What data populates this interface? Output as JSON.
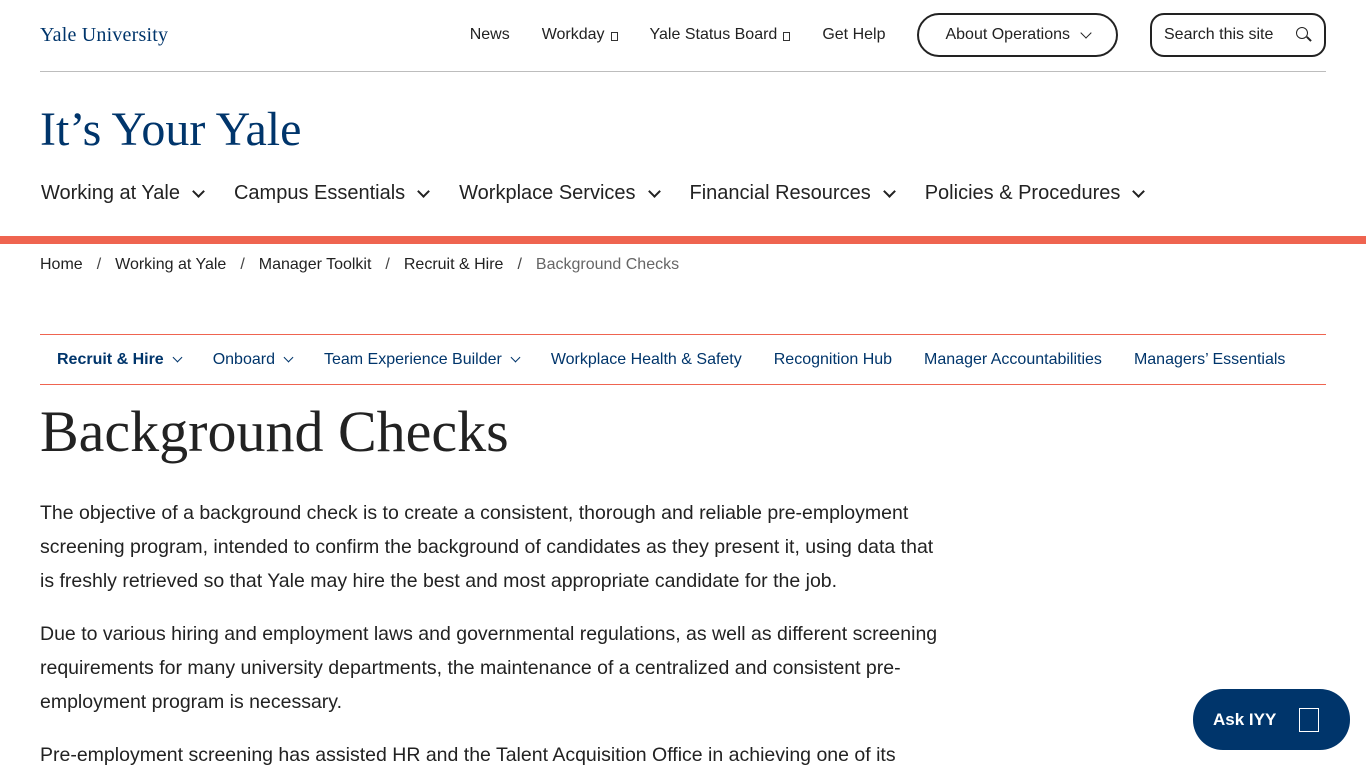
{
  "header": {
    "logo": "Yale University",
    "links": [
      {
        "label": "News",
        "external": false
      },
      {
        "label": "Workday",
        "external": true
      },
      {
        "label": "Yale Status Board",
        "external": true
      },
      {
        "label": "Get Help",
        "external": false
      }
    ],
    "about_button": "About Operations",
    "search_placeholder": "Search this site"
  },
  "site_title": "It’s Your Yale",
  "main_nav": [
    "Working at Yale",
    "Campus Essentials",
    "Workplace Services",
    "Financial Resources",
    "Policies & Procedures"
  ],
  "breadcrumb": [
    "Home",
    "Working at Yale",
    "Manager Toolkit",
    "Recruit & Hire",
    "Background Checks"
  ],
  "sub_nav": [
    {
      "label": "Recruit & Hire",
      "dropdown": true,
      "active": true
    },
    {
      "label": "Onboard",
      "dropdown": true,
      "active": false
    },
    {
      "label": "Team Experience Builder",
      "dropdown": true,
      "active": false
    },
    {
      "label": "Workplace Health & Safety",
      "dropdown": false,
      "active": false
    },
    {
      "label": "Recognition Hub",
      "dropdown": false,
      "active": false
    },
    {
      "label": "Manager Accountabilities",
      "dropdown": false,
      "active": false
    },
    {
      "label": "Managers’ Essentials",
      "dropdown": false,
      "active": false
    }
  ],
  "page_title": "Background Checks",
  "paragraphs": [
    "The objective of a background check is to create a consistent, thorough and reliable pre-employment screening program, intended to confirm the background of candidates as they present it, using data that is freshly retrieved so that Yale may hire the best and most appropriate candidate for the job.",
    "Due to various hiring and employment laws and governmental regulations, as well as different screening requirements for many university departments, the maintenance of a centralized and consistent pre-employment program is necessary.",
    "Pre-employment screening has assisted HR and the Talent Acquisition Office in achieving one of its"
  ],
  "ask_button": "Ask IYY",
  "colors": {
    "yale_blue": "#00356b",
    "accent": "#ef6450",
    "text": "#222222"
  }
}
